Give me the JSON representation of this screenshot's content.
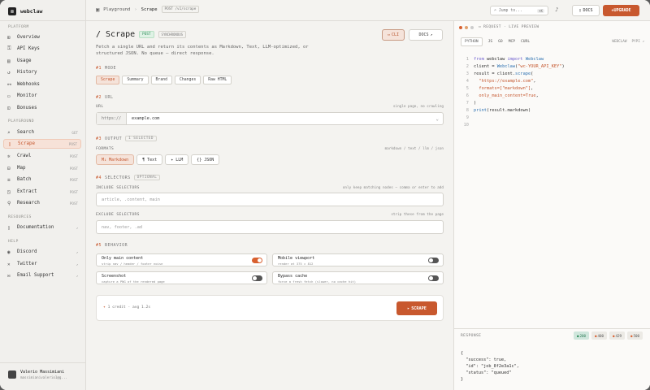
{
  "app": {
    "name": "webclaw"
  },
  "sidebar": {
    "platform_label": "PLATFORM",
    "platform": [
      {
        "label": "Overview"
      },
      {
        "label": "API Keys"
      },
      {
        "label": "Usage"
      },
      {
        "label": "History"
      },
      {
        "label": "Webhooks"
      },
      {
        "label": "Monitor"
      },
      {
        "label": "Bonuses"
      }
    ],
    "playground_label": "PLAYGROUND",
    "playground": [
      {
        "label": "Search",
        "method": "GET"
      },
      {
        "label": "Scrape",
        "method": "POST"
      },
      {
        "label": "Crawl",
        "method": "POST"
      },
      {
        "label": "Map",
        "method": "POST"
      },
      {
        "label": "Batch",
        "method": "POST"
      },
      {
        "label": "Extract",
        "method": "POST"
      },
      {
        "label": "Research",
        "method": "POST"
      }
    ],
    "resources_label": "RESOURCES",
    "resources": [
      {
        "label": "Documentation"
      }
    ],
    "help_label": "HELP",
    "help": [
      {
        "label": "Discord"
      },
      {
        "label": "Twitter"
      },
      {
        "label": "Email Support"
      }
    ],
    "user": {
      "name": "Valerio Massimiani",
      "email": "massimianivalerio1@g..."
    }
  },
  "topbar": {
    "crumb_root": "Playground",
    "crumb_current": "Scrape",
    "crumb_endpoint": "POST /v1/scrape",
    "jump_placeholder": "Jump to...",
    "jump_kbd": "⌘K",
    "docs": "DOCS",
    "upgrade": "UPGRADE"
  },
  "main": {
    "title": "/ Scrape",
    "method_tag": "POST",
    "sync_tag": "SYNCHRONOUS",
    "cli_button": "CLI",
    "docs_button": "DOCS",
    "description": "Fetch a single URL and return its contents as Markdown, Text, LLM-optimized, or structured JSON. No queue — direct response.",
    "mode": {
      "num": "#1",
      "label": "MODE",
      "options": [
        "Scrape",
        "Summary",
        "Brand",
        "Changes",
        "Raw HTML"
      ]
    },
    "url": {
      "num": "#2",
      "label": "URL",
      "field_label": "URL",
      "hint": "single page, no crawling",
      "prefix": "https://",
      "value": "example.com"
    },
    "output": {
      "num": "#3",
      "label": "OUTPUT",
      "chip": "1 SELECTED",
      "formats_label": "FORMATS",
      "formats_hint": "markdown / text / llm / json",
      "options": [
        {
          "label": "Markdown",
          "icon": "M↓"
        },
        {
          "label": "Text",
          "icon": "¶"
        },
        {
          "label": "LLM",
          "icon": "✦"
        },
        {
          "label": "JSON",
          "icon": "{}"
        }
      ]
    },
    "selectors": {
      "num": "#4",
      "label": "SELECTORS",
      "chip": "OPTIONAL",
      "include_label": "INCLUDE SELECTORS",
      "include_hint": "only keep matching nodes — comma or enter to add",
      "include_placeholder": "article, .content, main",
      "exclude_label": "EXCLUDE SELECTORS",
      "exclude_hint": "strip these from the page",
      "exclude_placeholder": "nav, footer, .ad"
    },
    "behavior": {
      "num": "#5",
      "label": "BEHAVIOR",
      "toggles": [
        {
          "title": "Only main content",
          "sub": "strip nav / header / footer noise",
          "on": true
        },
        {
          "title": "Mobile viewport",
          "sub": "render at 375 × 812",
          "on": false
        },
        {
          "title": "Screenshot",
          "sub": "capture a PNG of the rendered page",
          "on": false
        },
        {
          "title": "Bypass cache",
          "sub": "force a fresh fetch (slower, no cache hit)",
          "on": false
        }
      ]
    },
    "submit": {
      "credit": "1 credit · avg 1.2s",
      "button": "SCRAPE"
    }
  },
  "right": {
    "header": "REQUEST · LIVE PREVIEW",
    "langs": [
      "PYTHON",
      "JS",
      "GO",
      "MCP",
      "CURL"
    ],
    "selected_lang": "PYTHON",
    "meta": [
      "WEBCLAW",
      "PYPI ↗"
    ],
    "code_lines": [
      {
        "n": "1",
        "html": "<span class=\"kw\">from</span> webclaw <span class=\"kw\">import</span> <span class=\"fn\">Webclaw</span>"
      },
      {
        "n": "2",
        "html": "client = <span class=\"fn\">Webclaw</span>(<span class=\"str\">\"wc-YOUR_API_KEY\"</span>)"
      },
      {
        "n": "3",
        "html": "result = client.<span class=\"fn\">scrape</span>("
      },
      {
        "n": "4",
        "html": "  <span class=\"str\">\"https://example.com\"</span>,"
      },
      {
        "n": "5",
        "html": "  <span class=\"str\">formats=[\"markdown\"]</span>,"
      },
      {
        "n": "6",
        "html": "  <span class=\"str\">only_main_content=True</span>,"
      },
      {
        "n": "7",
        "html": ")"
      },
      {
        "n": "8",
        "html": "<span class=\"fn\">print</span>(result.markdown)"
      },
      {
        "n": "9",
        "html": ""
      },
      {
        "n": "10",
        "html": ""
      }
    ],
    "response_label": "RESPONSE",
    "codes": [
      "200",
      "400",
      "429",
      "500"
    ],
    "response_json": "{\n  \"success\": true,\n  \"id\": \"job_8f2e3a1c\",\n  \"status\": \"queued\"\n}"
  },
  "colors": {
    "accent": "#c8582e",
    "active_bg": "#f7e2d8",
    "ok": "#2a8a55"
  }
}
